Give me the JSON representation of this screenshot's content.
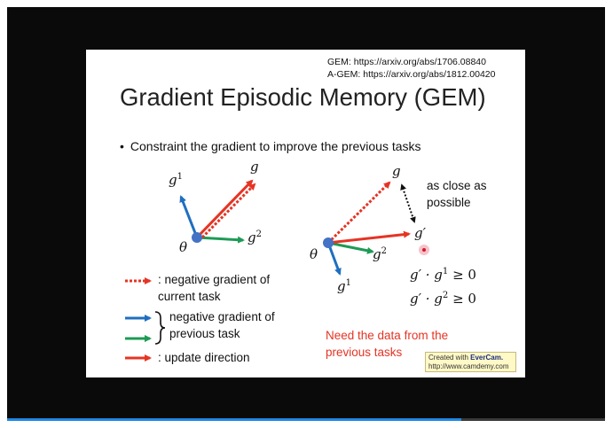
{
  "player": {
    "progress": 0.76,
    "colors": {
      "background": "#0a0a0a",
      "progress_fill": "#1e88e5"
    }
  },
  "slide": {
    "references": {
      "gem": "GEM: https://arxiv.org/abs/1706.08840",
      "agem": "A-GEM: https://arxiv.org/abs/1812.00420"
    },
    "title": "Gradient Episodic Memory (GEM)",
    "bullet": "Constraint the gradient to improve the previous tasks",
    "left_diagram": {
      "g": "g",
      "g1_base": "g",
      "g1_sup": "1",
      "g2_base": "g",
      "g2_sup": "2",
      "theta": "θ"
    },
    "right_diagram": {
      "g": "g",
      "g_prime": "g′",
      "g1_base": "g",
      "g1_sup": "1",
      "g2_base": "g",
      "g2_sup": "2",
      "theta": "θ",
      "note_line1": "as close as",
      "note_line2": "possible"
    },
    "constraints": {
      "c1_left": "g′ · g",
      "c1_sup": "1",
      "c1_right": " ≥ 0",
      "c2_left": "g′ · g",
      "c2_sup": "2",
      "c2_right": " ≥ 0"
    },
    "legend": {
      "dotted_line1": ": negative gradient of",
      "dotted_line2": "current task",
      "prev_line1": "negative gradient of",
      "prev_line2": "previous task",
      "update": ": update direction"
    },
    "need_data_line1": "Need the data from the",
    "need_data_line2": "previous tasks",
    "watermark": {
      "prefix": "Created with ",
      "brand": "EverCam.",
      "url": "http://www.camdemy.com"
    },
    "colors": {
      "red": "#e53424",
      "blue": "#1f6fbf",
      "green": "#1e9a55",
      "origin": "#4472c4"
    }
  }
}
